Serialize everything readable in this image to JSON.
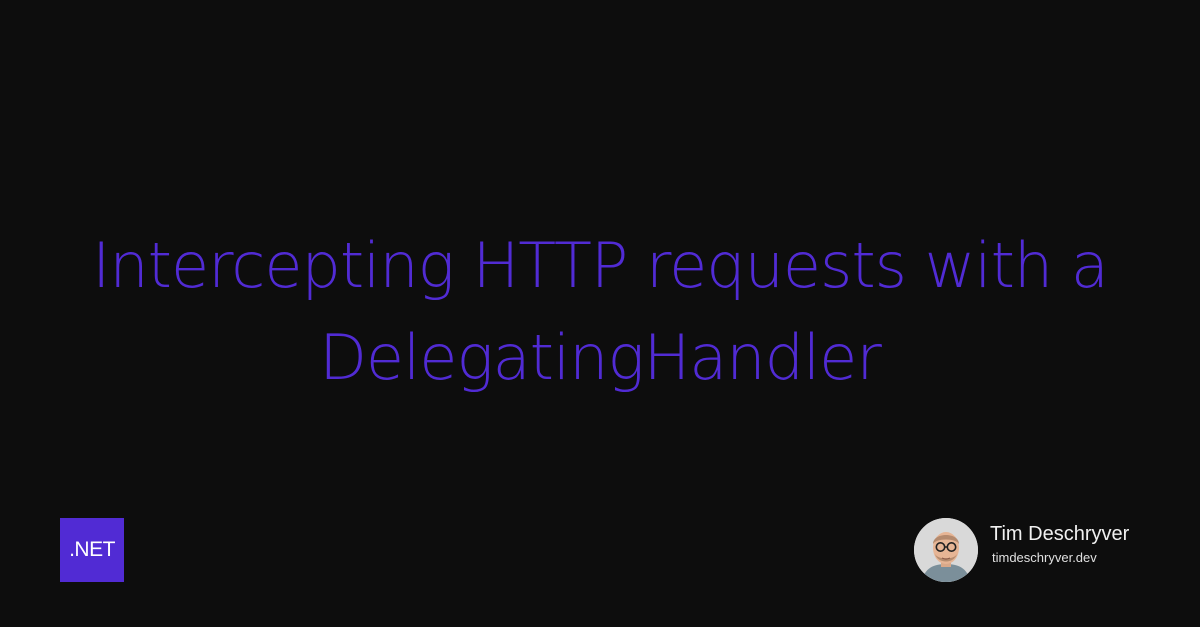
{
  "post": {
    "title": "Intercepting HTTP requests with a DelegatingHandler"
  },
  "badge": {
    "label": ".NET"
  },
  "author": {
    "name": "Tim Deschryver",
    "site": "timdeschryver.dev",
    "avatar_icon": "author-photo"
  },
  "colors": {
    "background": "#0d0d0d",
    "accent": "#512bd4",
    "text": "#f0f0f0"
  }
}
